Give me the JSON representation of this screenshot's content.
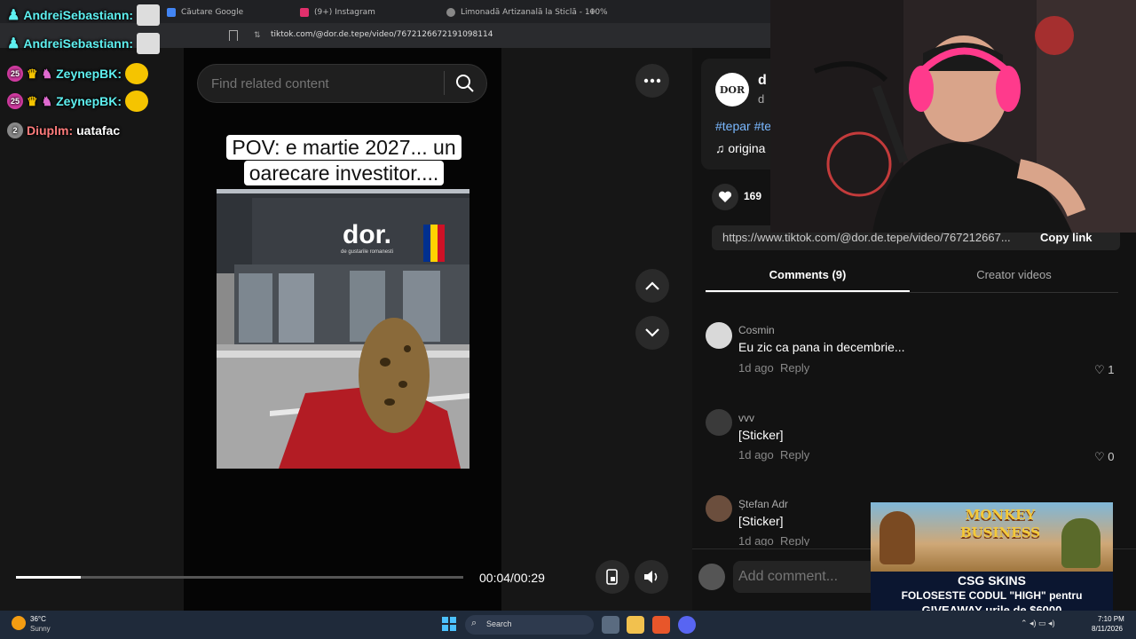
{
  "browser": {
    "tabs": [
      {
        "label": "Căutare Google",
        "color": "#4285f4"
      },
      {
        "label": "(9+) Instagram",
        "color": "#e1306c"
      },
      {
        "label": "Limonadă Artizanală la Sticlă - 100%",
        "color": "#888888"
      }
    ],
    "new_tab": "+",
    "url": "tiktok.com/@dor.de.tepe/video/7672126672191098114"
  },
  "chat": [
    {
      "user": "AndreiSebastiann:",
      "color": "#5ef0f0",
      "message": "",
      "badge": ""
    },
    {
      "user": "AndreiSebastiann:",
      "color": "#5ef0f0",
      "message": "",
      "badge": ""
    },
    {
      "user": "ZeynepBK:",
      "color": "#5ef0f0",
      "message": "",
      "badge": "25"
    },
    {
      "user": "ZeynepBK:",
      "color": "#5ef0f0",
      "message": "",
      "badge": "25"
    },
    {
      "user": "Diuplm:",
      "color": "#ff7b7b",
      "message": "uatafac",
      "badge": "2"
    }
  ],
  "search": {
    "placeholder": "Find related content"
  },
  "video": {
    "caption_line1": "POV: e martie 2027... un",
    "caption_line2": "oarecare investitor....",
    "store_logo": "dor.",
    "store_sub": "de gustarile romanesti",
    "time": "00:04/00:29",
    "progress": 0.145
  },
  "post": {
    "avatar_text": "DOR",
    "hashtags": "#tepar #te",
    "sound": "♫  origina",
    "likes": "169",
    "share_url": "https://www.tiktok.com/@dor.de.tepe/video/767212667...",
    "copy_link": "Copy link"
  },
  "tabs": {
    "comments": "Comments (9)",
    "creator": "Creator videos"
  },
  "comments": [
    {
      "name": "Cosmin",
      "text": "Eu zic ca pana in decembrie...",
      "age": "1d ago",
      "reply": "Reply",
      "likes": "1",
      "avatar": "#d9d9d9"
    },
    {
      "name": "vvv",
      "text": "[Sticker]",
      "age": "1d ago",
      "reply": "Reply",
      "likes": "0",
      "avatar": "#3a3a3a"
    },
    {
      "name": "Ștefan Adr",
      "text": "[Sticker]",
      "age": "1d ago",
      "reply": "Reply",
      "likes": "",
      "avatar": "#6b4e3d"
    }
  ],
  "comment_box": {
    "placeholder": "Add comment..."
  },
  "ad": {
    "title": "MONKEY BUSINESS",
    "brand": "CSG SKINS",
    "line1": "FOLOSESTE CODUL \"HIGH\" pentru",
    "line2": "GIVEAWAY-urile de $6000"
  },
  "taskbar": {
    "weather_temp": "36°C",
    "weather_desc": "Sunny",
    "search": "Search",
    "time": "7:10 PM",
    "date": "8/11/2026"
  }
}
